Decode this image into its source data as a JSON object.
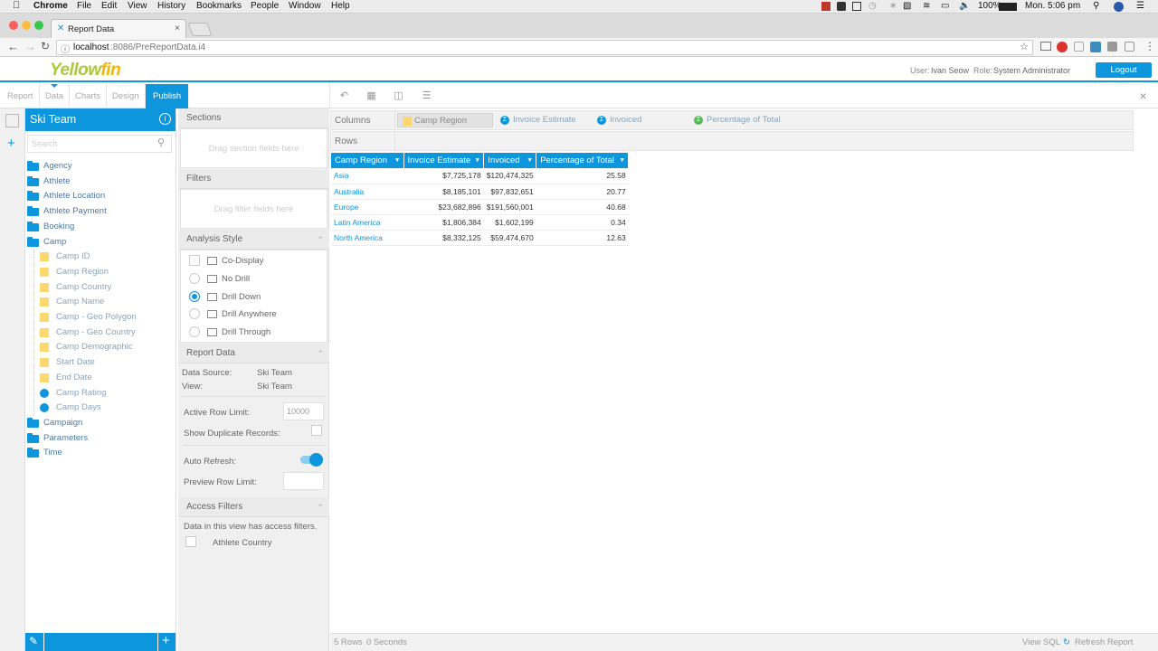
{
  "mac_menu": {
    "app": "Chrome",
    "items": [
      "File",
      "Edit",
      "View",
      "History",
      "Bookmarks",
      "People",
      "Window",
      "Help"
    ],
    "battery": "100%",
    "clock": "Mon. 5:06 pm"
  },
  "browser": {
    "tab_title": "Report Data",
    "url_host": "localhost",
    "url_rest": ":8086/PreReportData.i4"
  },
  "header": {
    "logo_part1": "Yellow",
    "logo_part2": "fin",
    "user_label": "User:",
    "user_name": "Ivan Seow",
    "role_label": "Role:",
    "role_name": "System Administrator",
    "logout": "Logout"
  },
  "nav": {
    "tabs": [
      "Report",
      "Data",
      "Charts",
      "Design",
      "Publish"
    ]
  },
  "left_panel": {
    "title": "Ski Team",
    "search_placeholder": "Search",
    "tree": [
      {
        "label": "Agency",
        "type": "folder",
        "level": 0
      },
      {
        "label": "Athlete",
        "type": "folder",
        "level": 0
      },
      {
        "label": "Athlete Location",
        "type": "folder",
        "level": 0
      },
      {
        "label": "Athlete Payment",
        "type": "folder",
        "level": 0
      },
      {
        "label": "Booking",
        "type": "folder",
        "level": 0
      },
      {
        "label": "Camp",
        "type": "folder-open",
        "level": 0
      },
      {
        "label": "Camp ID",
        "type": "dim",
        "level": 1
      },
      {
        "label": "Camp Region",
        "type": "dim",
        "level": 1
      },
      {
        "label": "Camp Country",
        "type": "dim",
        "level": 1
      },
      {
        "label": "Camp Name",
        "type": "dim",
        "level": 1
      },
      {
        "label": "Camp - Geo Polygon",
        "type": "dim",
        "level": 1
      },
      {
        "label": "Camp - Geo Country",
        "type": "dim",
        "level": 1
      },
      {
        "label": "Camp Demographic",
        "type": "dim",
        "level": 1
      },
      {
        "label": "Start Date",
        "type": "dim",
        "level": 1
      },
      {
        "label": "End Date",
        "type": "dim",
        "level": 1
      },
      {
        "label": "Camp Rating",
        "type": "metric",
        "level": 1
      },
      {
        "label": "Camp Days",
        "type": "metric",
        "level": 1
      },
      {
        "label": "Campaign",
        "type": "folder",
        "level": 0
      },
      {
        "label": "Parameters",
        "type": "folder",
        "level": 0
      },
      {
        "label": "Time",
        "type": "folder",
        "level": 0
      }
    ]
  },
  "middle_panel": {
    "sections_title": "Sections",
    "sections_drop": "Drag section fields here",
    "filters_title": "Filters",
    "filters_drop": "Drag filter fields here",
    "analysis_title": "Analysis Style",
    "co_display": "Co-Display",
    "analysis_options": [
      {
        "label": "No Drill",
        "selected": false
      },
      {
        "label": "Drill Down",
        "selected": true
      },
      {
        "label": "Drill Anywhere",
        "selected": false
      },
      {
        "label": "Drill Through",
        "selected": false
      }
    ],
    "report_data_title": "Report Data",
    "data_source_label": "Data Source:",
    "data_source_value": "Ski Team",
    "view_label": "View:",
    "view_value": "Ski Team",
    "active_row_limit_label": "Active Row Limit:",
    "active_row_limit_value": "10000",
    "show_duplicates_label": "Show Duplicate Records:",
    "auto_refresh_label": "Auto Refresh:",
    "preview_row_limit_label": "Preview Row Limit:",
    "access_filters_title": "Access Filters",
    "access_filters_text": "Data in this view has access filters.",
    "access_filter_item": "Athlete Country"
  },
  "content": {
    "columns_label": "Columns",
    "rows_label": "Rows",
    "column_fields": [
      {
        "label": "Camp Region",
        "kind": "dimension"
      },
      {
        "label": "Invoice Estimate",
        "kind": "metric"
      },
      {
        "label": "Invoiced",
        "kind": "metric"
      },
      {
        "label": "Percentage of Total",
        "kind": "calc"
      }
    ],
    "table": {
      "headers": [
        "Camp Region",
        "Invoice Estimate",
        "Invoiced",
        "Percentage of Total"
      ],
      "rows": [
        [
          "Asia",
          "$7,725,178",
          "$120,474,325",
          "25.58"
        ],
        [
          "Australia",
          "$8,185,101",
          "$97,832,651",
          "20.77"
        ],
        [
          "Europe",
          "$23,682,896",
          "$191,560,001",
          "40.68"
        ],
        [
          "Latin America",
          "$1,806,384",
          "$1,602,199",
          "0.34"
        ],
        [
          "North America",
          "$8,332,125",
          "$59,474,670",
          "12.63"
        ]
      ]
    }
  },
  "status": {
    "rows": "5 Rows",
    "seconds": "0 Seconds",
    "view_sql": "View SQL",
    "refresh": "Refresh Report"
  },
  "colors": {
    "accent": "#0d96dc",
    "dimension": "#fcd86f",
    "calc": "#5cb85c"
  }
}
